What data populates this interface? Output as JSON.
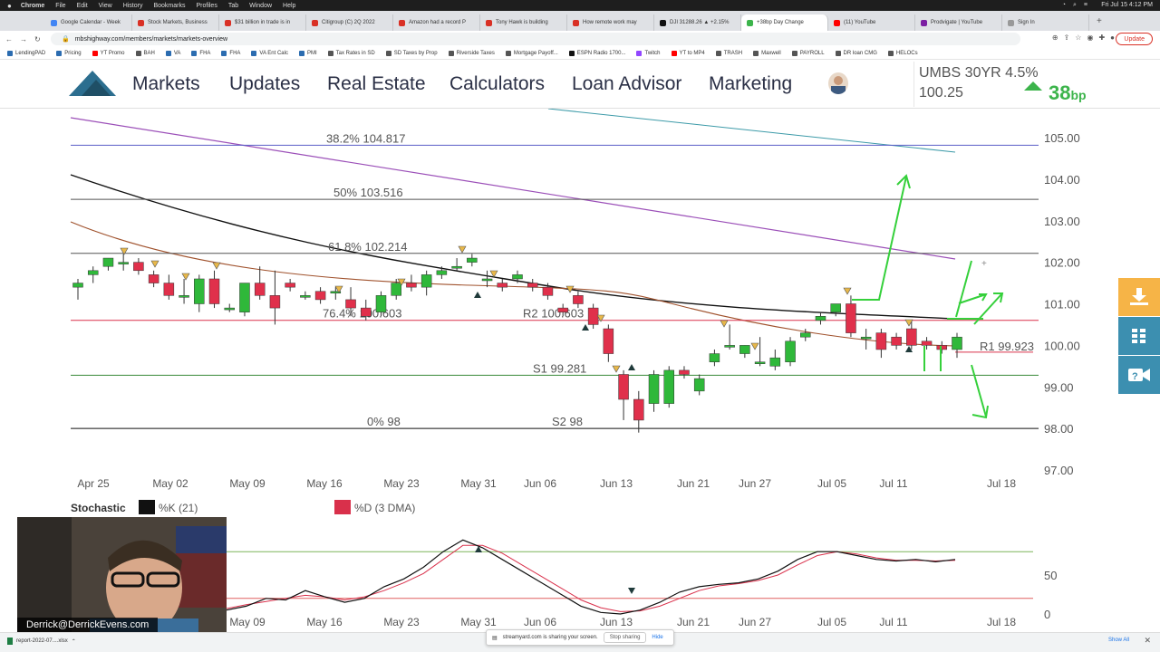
{
  "mac_menu": {
    "app": "Chrome",
    "items": [
      "File",
      "Edit",
      "View",
      "History",
      "Bookmarks",
      "Profiles",
      "Tab",
      "Window",
      "Help"
    ],
    "clock": "Fri Jul 15  4:12 PM"
  },
  "browser": {
    "tabs": [
      {
        "label": "Google Calendar - Week",
        "color": "#4285f4"
      },
      {
        "label": "Stock Markets, Business",
        "color": "#d93025"
      },
      {
        "label": "$31 billion in trade is in",
        "color": "#d93025"
      },
      {
        "label": "Citigroup (C) 2Q 2022",
        "color": "#d93025"
      },
      {
        "label": "Amazon had a record P",
        "color": "#d93025"
      },
      {
        "label": "Tony Hawk is building",
        "color": "#d93025"
      },
      {
        "label": "How remote work may",
        "color": "#d93025"
      },
      {
        "label": "DJI 31288.26 ▲ +2.15%",
        "color": "#111"
      },
      {
        "label": "+38bp Day Change",
        "color": "#3cb44b",
        "active": true
      },
      {
        "label": "(11) YouTube",
        "color": "#ff0000"
      },
      {
        "label": "Prodvigate | YouTube",
        "color": "#7b1fa2"
      },
      {
        "label": "Sign In",
        "color": "#999"
      }
    ],
    "url": "mbshighway.com/members/markets/markets-overview",
    "update_label": "Update",
    "bookmarks": [
      {
        "label": "LendingPAD",
        "color": "#2b6cb0"
      },
      {
        "label": "Pricing",
        "color": "#2b6cb0"
      },
      {
        "label": "YT Promo",
        "color": "#ff0000"
      },
      {
        "label": "BAH",
        "color": "#555"
      },
      {
        "label": "VA",
        "color": "#2b6cb0"
      },
      {
        "label": "FHA",
        "color": "#2b6cb0"
      },
      {
        "label": "FHA",
        "color": "#2b6cb0"
      },
      {
        "label": "VA Ent Calc",
        "color": "#2b6cb0"
      },
      {
        "label": "PMI",
        "color": "#2b6cb0"
      },
      {
        "label": "Tax Rates in SD",
        "color": "#555"
      },
      {
        "label": "SD Taxes by Prop",
        "color": "#555"
      },
      {
        "label": "Riverside Taxes",
        "color": "#555"
      },
      {
        "label": "Mortgage Payoff...",
        "color": "#555"
      },
      {
        "label": "ESPN Radio 1700...",
        "color": "#111"
      },
      {
        "label": "Twitch",
        "color": "#9146ff"
      },
      {
        "label": "YT to MP4",
        "color": "#ff0000"
      },
      {
        "label": "TRASH",
        "color": "#555"
      },
      {
        "label": "Maxwell",
        "color": "#555"
      },
      {
        "label": "PAYROLL",
        "color": "#555"
      },
      {
        "label": "DR loan CMG",
        "color": "#555"
      },
      {
        "label": "HELOCs",
        "color": "#555"
      }
    ]
  },
  "site": {
    "nav": [
      "Markets",
      "Updates",
      "Real Estate",
      "Calculators",
      "Loan Advisor",
      "Marketing"
    ],
    "ticker": {
      "name": "UMBS 30YR 4.5%",
      "price": "100.25",
      "change": "38",
      "change_unit": "bp"
    }
  },
  "chart_data": {
    "type": "candlestick",
    "ylim": [
      97.0,
      105.0
    ],
    "y_ticks": [
      "105.00",
      "104.00",
      "103.00",
      "102.00",
      "101.00",
      "100.00",
      "99.00",
      "98.00",
      "97.00"
    ],
    "x_ticks": [
      "Apr 25",
      "May 02",
      "May 09",
      "May 16",
      "May 23",
      "May 31",
      "Jun 06",
      "Jun 13",
      "Jun 21",
      "Jun 27",
      "Jul 05",
      "Jul 11",
      "Jul 18"
    ],
    "levels": [
      {
        "label": "38.2% 104.817",
        "value": 104.817,
        "color": "#5b5fc7"
      },
      {
        "label": "50% 103.516",
        "value": 103.516,
        "color": "#555"
      },
      {
        "label": "61.8% 102.214",
        "value": 102.214,
        "color": "#555"
      },
      {
        "label": "76.4% 100.603",
        "value": 100.603,
        "color": "#d9304b"
      },
      {
        "label": "R2 100.603",
        "value": 100.603,
        "color": "#d9304b"
      },
      {
        "label": "S1 99.281",
        "value": 99.281,
        "color": "#3a8a3a"
      },
      {
        "label": "0% 98",
        "value": 98.0,
        "color": "#111"
      },
      {
        "label": "S2 98",
        "value": 98.0,
        "color": "#111"
      },
      {
        "label": "R1 99.923",
        "value": 99.923,
        "color": "#d9304b"
      }
    ],
    "candles": [
      {
        "o": 101.4,
        "h": 101.6,
        "l": 101.1,
        "c": 101.5
      },
      {
        "o": 101.7,
        "h": 101.9,
        "l": 101.5,
        "c": 101.8
      },
      {
        "o": 101.9,
        "h": 102.1,
        "l": 101.8,
        "c": 102.1
      },
      {
        "o": 102.0,
        "h": 102.2,
        "l": 101.8,
        "c": 102.0
      },
      {
        "o": 102.0,
        "h": 102.1,
        "l": 101.7,
        "c": 101.8
      },
      {
        "o": 101.7,
        "h": 101.8,
        "l": 101.4,
        "c": 101.5
      },
      {
        "o": 101.5,
        "h": 101.7,
        "l": 101.1,
        "c": 101.2
      },
      {
        "o": 101.2,
        "h": 101.6,
        "l": 101.0,
        "c": 101.2
      },
      {
        "o": 101.0,
        "h": 101.7,
        "l": 100.8,
        "c": 101.6
      },
      {
        "o": 101.6,
        "h": 101.8,
        "l": 100.9,
        "c": 101.0
      },
      {
        "o": 100.9,
        "h": 101.0,
        "l": 100.8,
        "c": 100.9
      },
      {
        "o": 100.8,
        "h": 101.5,
        "l": 100.7,
        "c": 101.5
      },
      {
        "o": 101.5,
        "h": 101.9,
        "l": 101.1,
        "c": 101.2
      },
      {
        "o": 101.2,
        "h": 101.8,
        "l": 100.5,
        "c": 100.9
      },
      {
        "o": 101.5,
        "h": 101.6,
        "l": 101.3,
        "c": 101.4
      },
      {
        "o": 101.2,
        "h": 101.3,
        "l": 101.1,
        "c": 101.2
      },
      {
        "o": 101.3,
        "h": 101.4,
        "l": 101.0,
        "c": 101.1
      },
      {
        "o": 101.3,
        "h": 101.4,
        "l": 101.1,
        "c": 101.3
      },
      {
        "o": 101.1,
        "h": 101.4,
        "l": 100.7,
        "c": 100.9
      },
      {
        "o": 100.9,
        "h": 101.1,
        "l": 100.6,
        "c": 100.7
      },
      {
        "o": 100.8,
        "h": 101.3,
        "l": 100.7,
        "c": 101.2
      },
      {
        "o": 101.2,
        "h": 101.6,
        "l": 101.1,
        "c": 101.5
      },
      {
        "o": 101.5,
        "h": 101.7,
        "l": 101.3,
        "c": 101.4
      },
      {
        "o": 101.4,
        "h": 101.8,
        "l": 101.2,
        "c": 101.7
      },
      {
        "o": 101.7,
        "h": 101.9,
        "l": 101.6,
        "c": 101.8
      },
      {
        "o": 101.9,
        "h": 102.1,
        "l": 101.8,
        "c": 101.9
      },
      {
        "o": 102.0,
        "h": 102.2,
        "l": 101.9,
        "c": 102.1
      },
      {
        "o": 101.6,
        "h": 101.8,
        "l": 101.4,
        "c": 101.6
      },
      {
        "o": 101.5,
        "h": 101.6,
        "l": 101.3,
        "c": 101.4
      },
      {
        "o": 101.6,
        "h": 101.8,
        "l": 101.5,
        "c": 101.7
      },
      {
        "o": 101.5,
        "h": 101.6,
        "l": 101.3,
        "c": 101.4
      },
      {
        "o": 101.4,
        "h": 101.5,
        "l": 101.1,
        "c": 101.2
      },
      {
        "o": 100.9,
        "h": 101.0,
        "l": 100.7,
        "c": 100.8
      },
      {
        "o": 101.2,
        "h": 101.3,
        "l": 100.9,
        "c": 101.0
      },
      {
        "o": 100.9,
        "h": 101.0,
        "l": 100.4,
        "c": 100.5
      },
      {
        "o": 100.4,
        "h": 100.5,
        "l": 99.6,
        "c": 99.8
      },
      {
        "o": 99.3,
        "h": 99.4,
        "l": 98.2,
        "c": 98.7
      },
      {
        "o": 98.7,
        "h": 98.9,
        "l": 97.9,
        "c": 98.2
      },
      {
        "o": 98.6,
        "h": 99.4,
        "l": 98.4,
        "c": 99.3
      },
      {
        "o": 98.6,
        "h": 99.5,
        "l": 98.5,
        "c": 99.4
      },
      {
        "o": 99.4,
        "h": 99.5,
        "l": 99.2,
        "c": 99.3
      },
      {
        "o": 98.9,
        "h": 99.3,
        "l": 98.8,
        "c": 99.2
      },
      {
        "o": 99.6,
        "h": 99.9,
        "l": 99.5,
        "c": 99.8
      },
      {
        "o": 100.0,
        "h": 100.5,
        "l": 99.9,
        "c": 100.0
      },
      {
        "o": 99.8,
        "h": 100.0,
        "l": 99.7,
        "c": 100.0
      },
      {
        "o": 99.6,
        "h": 100.2,
        "l": 99.5,
        "c": 99.6
      },
      {
        "o": 99.5,
        "h": 99.9,
        "l": 99.4,
        "c": 99.7
      },
      {
        "o": 99.6,
        "h": 100.2,
        "l": 99.5,
        "c": 100.1
      },
      {
        "o": 100.2,
        "h": 100.4,
        "l": 100.1,
        "c": 100.3
      },
      {
        "o": 100.6,
        "h": 100.8,
        "l": 100.5,
        "c": 100.7
      },
      {
        "o": 100.8,
        "h": 101.0,
        "l": 100.7,
        "c": 101.0
      },
      {
        "o": 101.0,
        "h": 101.2,
        "l": 100.2,
        "c": 100.3
      },
      {
        "o": 100.2,
        "h": 100.4,
        "l": 99.9,
        "c": 100.2
      },
      {
        "o": 100.3,
        "h": 100.4,
        "l": 99.7,
        "c": 99.9
      },
      {
        "o": 100.2,
        "h": 100.3,
        "l": 99.9,
        "c": 100.0
      },
      {
        "o": 100.4,
        "h": 100.6,
        "l": 99.9,
        "c": 100.0
      },
      {
        "o": 100.1,
        "h": 100.2,
        "l": 99.9,
        "c": 100.0
      },
      {
        "o": 100.0,
        "h": 100.1,
        "l": 99.8,
        "c": 99.9
      },
      {
        "o": 99.9,
        "h": 100.3,
        "l": 99.7,
        "c": 100.2
      }
    ],
    "stochastic": {
      "title": "Stochastic",
      "legend": [
        {
          "name": "%K (21)",
          "color": "#111"
        },
        {
          "name": "%D (3 DMA)",
          "color": "#d9304b"
        }
      ],
      "y_ticks": [
        "50",
        "0"
      ],
      "x_ticks": [
        "May 09",
        "May 16",
        "May 23",
        "May 31",
        "Jun 06",
        "Jun 13",
        "Jun 21",
        "Jun 27",
        "Jul 05",
        "Jul 11",
        "Jul 18"
      ],
      "bands": [
        80,
        20
      ],
      "k": [
        5,
        10,
        20,
        18,
        30,
        22,
        15,
        20,
        35,
        45,
        60,
        80,
        95,
        85,
        70,
        55,
        40,
        25,
        10,
        2,
        0,
        5,
        15,
        28,
        35,
        38,
        40,
        45,
        55,
        70,
        80,
        80,
        75,
        70,
        68,
        70,
        67,
        70
      ],
      "d": [
        7,
        12,
        16,
        20,
        24,
        22,
        18,
        22,
        30,
        40,
        52,
        70,
        88,
        88,
        78,
        63,
        48,
        33,
        18,
        8,
        3,
        4,
        10,
        20,
        30,
        36,
        39,
        43,
        50,
        63,
        75,
        80,
        77,
        72,
        69,
        69,
        68,
        69
      ]
    }
  },
  "presenter": {
    "label": "Derrick@DerrickEvens.com"
  },
  "footer": {
    "download_file": "report-2022-07....xlsx",
    "share_text": "streamyard.com is sharing your screen.",
    "stop_label": "Stop sharing",
    "hide_label": "Hide",
    "show_all": "Show All"
  }
}
